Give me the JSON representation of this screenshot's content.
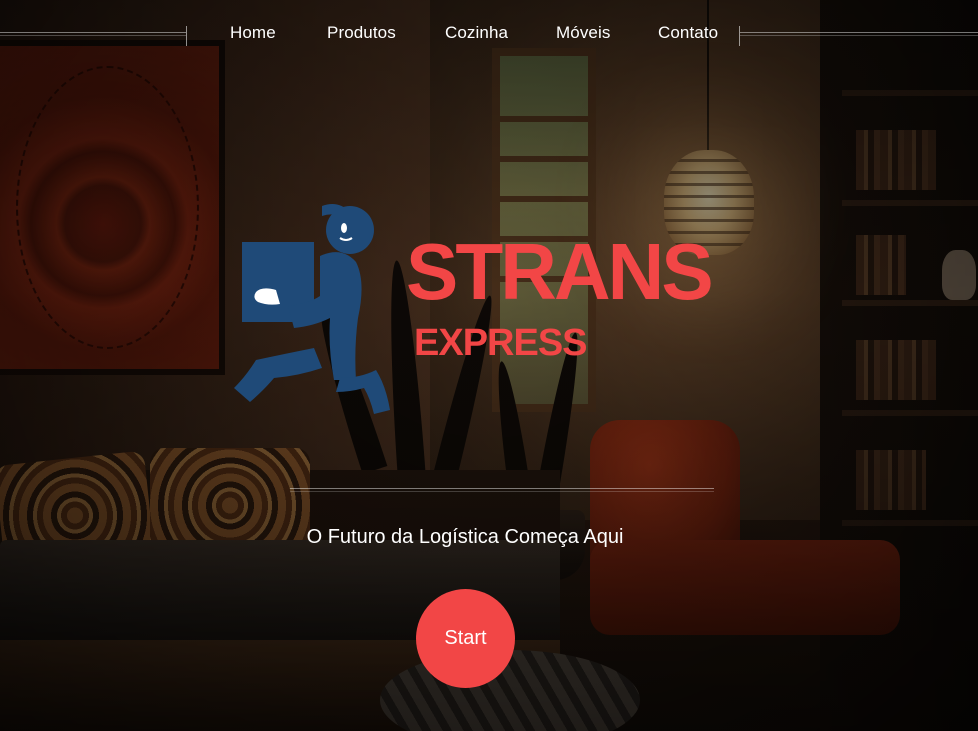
{
  "nav": {
    "items": [
      {
        "label": "Home"
      },
      {
        "label": "Produtos"
      },
      {
        "label": "Cozinha"
      },
      {
        "label": "Móveis"
      },
      {
        "label": "Contato"
      }
    ]
  },
  "logo": {
    "line1": "STRANS",
    "line2": "EXPRESS",
    "icon": "delivery-man-with-box-icon",
    "colors": {
      "text": "#f24646",
      "figure": "#1f4a78"
    }
  },
  "hero": {
    "tagline": "O Futuro da Logística Começa Aqui",
    "start_label": "Start"
  },
  "colors": {
    "accent": "#f24646",
    "text": "#ffffff"
  }
}
